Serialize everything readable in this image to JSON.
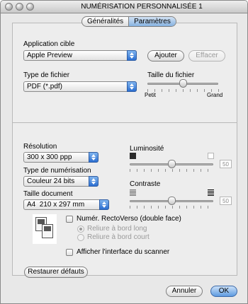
{
  "window": {
    "title": "NUMÉRISATION PERSONNALISÉE 1"
  },
  "tabs": [
    {
      "label": "Généralités",
      "selected": false
    },
    {
      "label": "Paramètres",
      "selected": true
    }
  ],
  "target_app": {
    "label": "Application cible",
    "value": "Apple Preview",
    "add_label": "Ajouter",
    "remove_label": "Effacer"
  },
  "file_type": {
    "label": "Type de fichier",
    "value": "PDF (*.pdf)"
  },
  "file_size": {
    "label": "Taille du fichier",
    "min_label": "Petit",
    "max_label": "Grand",
    "level": 0.5
  },
  "resolution": {
    "label": "Résolution",
    "value": "300 x 300 ppp"
  },
  "scan_type": {
    "label": "Type de numérisation",
    "value": "Couleur 24 bits"
  },
  "doc_size": {
    "label": "Taille document",
    "value": "A4  210 x 297 mm"
  },
  "brightness": {
    "label": "Luminosité",
    "value": "50"
  },
  "contrast": {
    "label": "Contraste",
    "value": "50"
  },
  "duplex": {
    "label": "Numér. RectoVerso (double face)",
    "options": [
      "Reliure à bord long",
      "Reliure à bord court"
    ]
  },
  "show_interface": {
    "label": "Afficher l'interface du scanner"
  },
  "footer": {
    "restore_label": "Restaurer défauts",
    "cancel_label": "Annuler",
    "ok_label": "OK"
  }
}
